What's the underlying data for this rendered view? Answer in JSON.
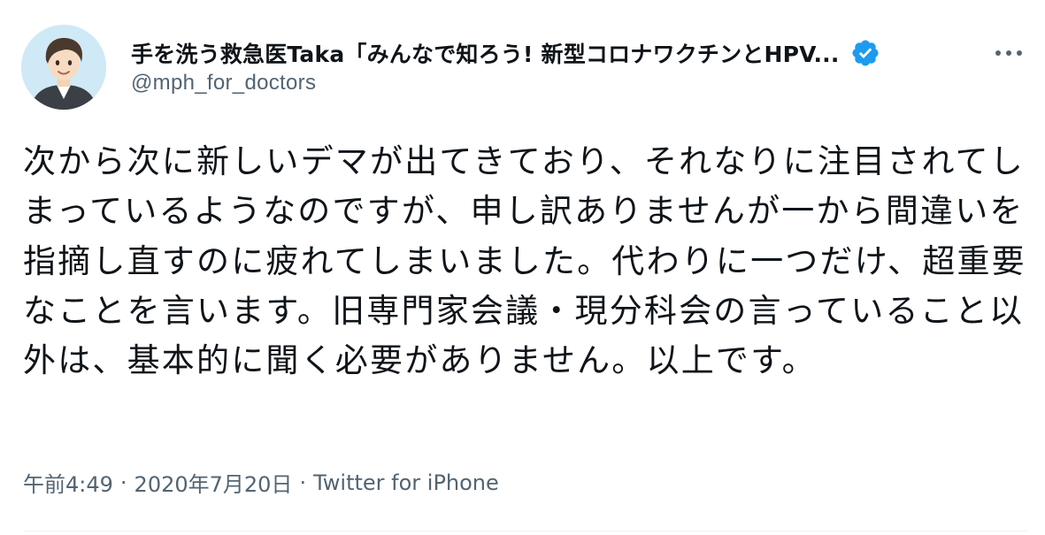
{
  "tweet": {
    "display_name": "手を洗う救急医Taka「みんなで知ろう! 新型コロナワクチンとHPV...",
    "handle": "@mph_for_doctors",
    "verified_icon": "verified-badge-icon",
    "more_icon": "more-options-icon",
    "text": "次から次に新しいデマが出てきており、それなりに注目されてしまっているようなのですが、申し訳ありませんが一から間違いを指摘し直すのに疲れてしまいました。代わりに一つだけ、超重要なことを言います。旧専門家会議・現分科会の言っていること以外は、基本的に聞く必要がありません。以上です。",
    "time": "午前4:49",
    "date": "2020年7月20日",
    "source": "Twitter for iPhone",
    "separator": "·"
  },
  "colors": {
    "text": "#0f1419",
    "secondary": "#536471",
    "verified": "#1d9bf0",
    "divider": "#eff3f4"
  }
}
